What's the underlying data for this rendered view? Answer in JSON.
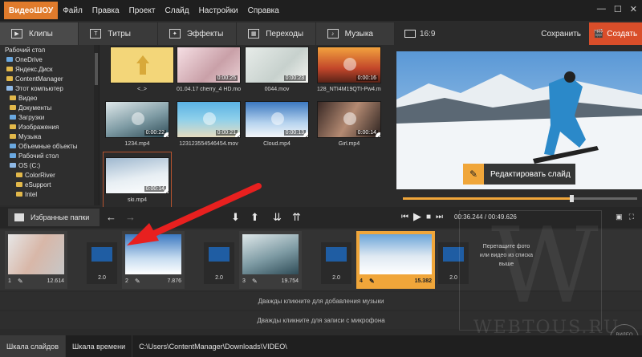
{
  "app": {
    "logo": "ВидеоШОУ",
    "menu": [
      "Файл",
      "Правка",
      "Проект",
      "Слайд",
      "Настройки",
      "Справка"
    ]
  },
  "tabs": [
    {
      "label": "Клипы",
      "icon": "clips-icon"
    },
    {
      "label": "Титры",
      "icon": "titles-icon"
    },
    {
      "label": "Эффекты",
      "icon": "effects-icon"
    },
    {
      "label": "Переходы",
      "icon": "transitions-icon"
    },
    {
      "label": "Музыка",
      "icon": "music-icon"
    }
  ],
  "right_header": {
    "ratio": "16:9",
    "save": "Сохранить",
    "create": "Создать"
  },
  "tree": [
    "Рабочий стол",
    "OneDrive",
    "Яндекс.Диск",
    "ContentManager",
    "Этот компьютер",
    "Видео",
    "Документы",
    "Загрузки",
    "Изображения",
    "Музыка",
    "Объемные объекты",
    "Рабочий стол",
    "OS (C:)",
    "ColorRiver",
    "eSupport",
    "Intel"
  ],
  "files": [
    {
      "name": "<..>",
      "duration": ""
    },
    {
      "name": "01.04.17 cherry_4 HD.mov",
      "duration": "0:00:25"
    },
    {
      "name": "0044.mov",
      "duration": "0:00:23"
    },
    {
      "name": "128_NTI4M19QTI-Pw4.mp4",
      "duration": "0:00:16"
    },
    {
      "name": "1234.mp4",
      "duration": "0:00:22"
    },
    {
      "name": "123123554546454.mov",
      "duration": "0:00:21"
    },
    {
      "name": "Cloud.mp4",
      "duration": "0:00:13"
    },
    {
      "name": "Girl.mp4",
      "duration": "0:00:14"
    },
    {
      "name": "ski.mp4",
      "duration": "0:00:14"
    }
  ],
  "preview": {
    "edit_slide": "Редактировать слайд",
    "current_time": "00:36.244",
    "total_time": "00:49.626",
    "progress": 0.72
  },
  "toolbar": {
    "favorites": "Избранные папки"
  },
  "timeline": {
    "slides": [
      {
        "num": "1",
        "duration": "12.614"
      },
      {
        "num": "2",
        "duration": "7.876"
      },
      {
        "num": "3",
        "duration": "19.754"
      },
      {
        "num": "4",
        "duration": "15.382"
      }
    ],
    "transitions": [
      "2.0",
      "2.0",
      "2.0",
      "2.0"
    ],
    "hint": "Перетащите фото или видео из списка выше"
  },
  "tracks": {
    "music": "Дважды кликните для добавления музыки",
    "mic": "Дважды кликните для записи с микрофона"
  },
  "bottom": {
    "tab_slides": "Шкала слайдов",
    "tab_time": "Шкала времени",
    "path": "C:\\Users\\ContentManager\\Downloads\\VIDEO\\"
  },
  "watermark": {
    "text": "WEBTOUS.RU",
    "badge": "ВИДЕО ШОУ"
  },
  "colors": {
    "accent": "#f0a63a",
    "create": "#d94e2a",
    "arrow": "#e8201f"
  }
}
